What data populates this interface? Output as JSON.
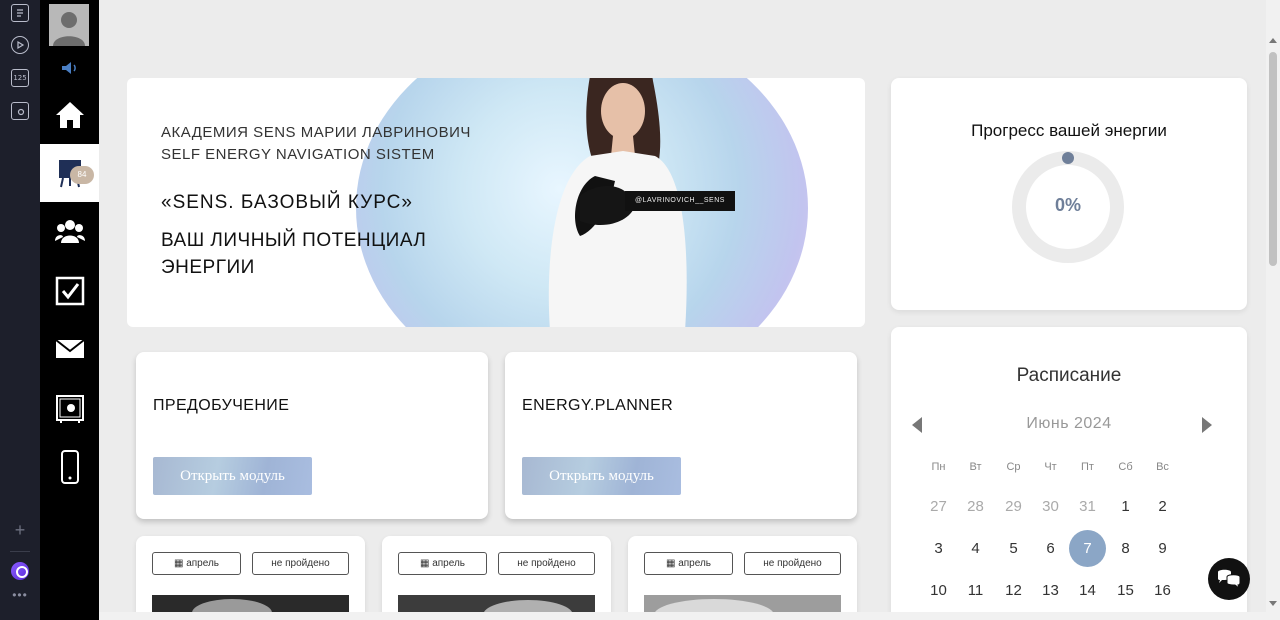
{
  "browser_strip": {
    "icons": [
      "notes-icon",
      "play-icon",
      "counter-icon",
      "camera-icon"
    ],
    "counter_label": "125"
  },
  "sidebar": {
    "badge": "84",
    "items": [
      "home-icon",
      "course-icon",
      "community-icon",
      "tasks-icon",
      "mail-icon",
      "safe-icon",
      "phone-icon"
    ]
  },
  "hero": {
    "line1": "АКАДЕМИЯ SENS МАРИИ ЛАВРИНОВИЧ",
    "line2": "SELF ENERGY NAVIGATION SISTEM",
    "course": "«SENS. БАЗОВЫЙ КУРС»",
    "subtitle": "ВАШ ЛИЧНЫЙ ПОТЕНЦИАЛ ЭНЕРГИИ",
    "tag": "@LAVRINOVICH__SENS"
  },
  "energy": {
    "title": "Прогресс вашей энергии",
    "percent": "0%",
    "progress_fraction": 0
  },
  "modules": [
    {
      "title": "ПРЕДОБУЧЕНИЕ",
      "button": "Открыть модуль"
    },
    {
      "title": "ENERGY.PLANNER",
      "button": "Открыть модуль"
    }
  ],
  "lessons": [
    {
      "date": "апрель",
      "status": "не пройдено"
    },
    {
      "date": "апрель",
      "status": "не пройдено"
    },
    {
      "date": "апрель",
      "status": "не пройдено"
    }
  ],
  "schedule": {
    "title": "Расписание",
    "month": "Июнь  2024",
    "weekdays": [
      "Пн",
      "Вт",
      "Ср",
      "Чт",
      "Пт",
      "Сб",
      "Вс"
    ],
    "weeks": [
      [
        "27",
        "28",
        "29",
        "30",
        "31",
        "1",
        "2"
      ],
      [
        "3",
        "4",
        "5",
        "6",
        "7",
        "8",
        "9"
      ],
      [
        "10",
        "11",
        "12",
        "13",
        "14",
        "15",
        "16"
      ]
    ],
    "today": "7"
  },
  "colors": {
    "accent": "#8ba6c6",
    "progress": "#6f7f99",
    "sidebar_bg": "#000000",
    "strip_bg": "#1d1f2b"
  }
}
